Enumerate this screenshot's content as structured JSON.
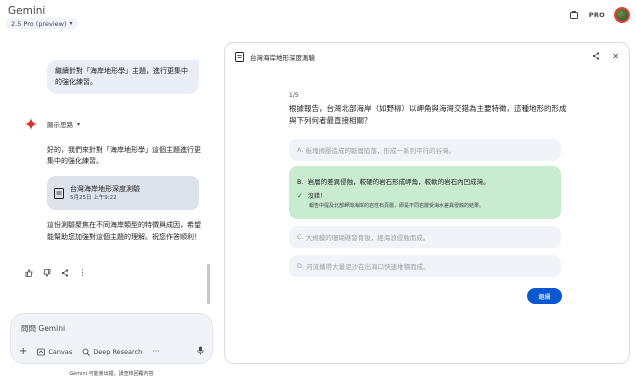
{
  "header": {
    "app_title": "Gemini",
    "model_label": "2.5 Pro (preview)",
    "pro_badge": "PRO",
    "icons": [
      "chevron-down-icon",
      "share-screen-icon",
      "avatar"
    ]
  },
  "chat": {
    "user_message": "繼續針對「海岸地形學」主題，進行更集中的強化練習。",
    "thinking_label": "顯示思路",
    "reply_intro": "好的，我們來針對「海岸地形學」這個主題進行更集中的強化練習。",
    "doc_card": {
      "title": "台灣海岸地形深度測驗",
      "date": "5月25日 上午9:22"
    },
    "reply_outro": "這份測驗聚焦在不同海岸類型的特徵與成因，希望能幫助您加強對這個主題的理解。祝您作答順利！",
    "action_icons": [
      "thumb-up-icon",
      "thumb-down-icon",
      "share-icon",
      "more-vert-icon"
    ]
  },
  "input": {
    "placeholder": "問問 Gemini",
    "tools": {
      "canvas_label": "Canvas",
      "deep_research_label": "Deep Research",
      "more_label": "···"
    },
    "disclaimer": "Gemini 可能會出錯，請查核回覆內容"
  },
  "quiz": {
    "title": "台灣海岸地形深度測驗",
    "progress": "1/5",
    "question": "根據報告，台灣北部海岸（如野柳）以岬角與海灣交錯為主要特徵，這種地形的形成與下列何者最直接相關？",
    "options": [
      {
        "label": "A.",
        "text": "板塊擠壓造成的斷層陷落，形成一系列平行的谷灣。"
      },
      {
        "label": "B.",
        "text": "岩層的差異侵蝕，較硬的岩石形成岬角，較軟的岩石內凹成灣。"
      },
      {
        "label": "C.",
        "text": "大規模的珊瑚礁發育後，經海浪侵蝕而成。"
      },
      {
        "label": "D.",
        "text": "河流攜帶大量泥沙在出海口快速堆積而成。"
      }
    ],
    "feedback_title": "沒錯！",
    "feedback_detail": "報告中提及北部岬灣海岸的岩性石頁層，即是不同岩層受海水差異侵蝕的結果。",
    "next_label": "繼續"
  },
  "colors": {
    "accent": "#0b57d0",
    "correct_bg": "#c9ebcf",
    "option_bg": "#f0f4f9",
    "user_bubble_bg": "#e9eef6"
  }
}
